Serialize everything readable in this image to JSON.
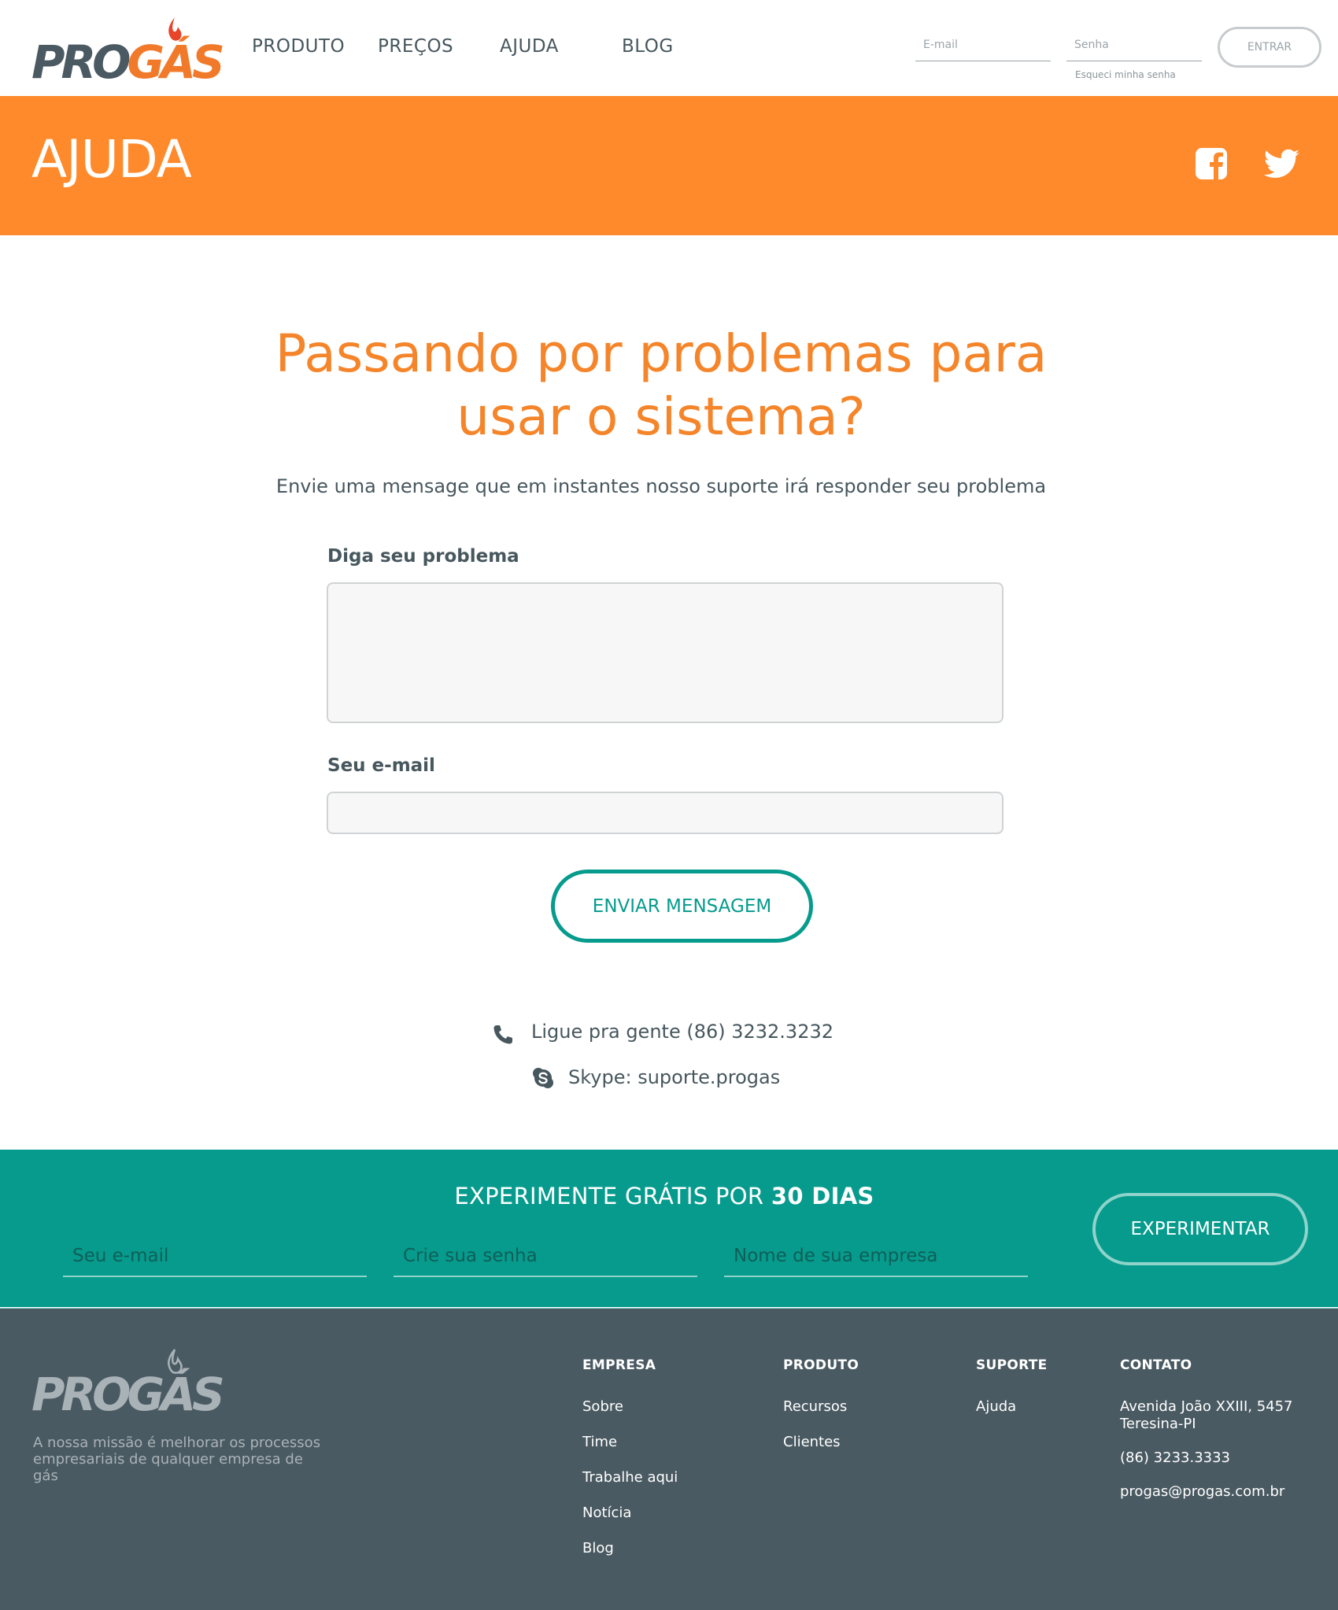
{
  "header": {
    "logo": {
      "part1": "PRO",
      "part2": "GÁS"
    },
    "nav": [
      "PRODUTO",
      "PREÇOS",
      "AJUDA",
      "BLOG"
    ],
    "email_placeholder": "E-mail",
    "password_placeholder": "Senha",
    "forgot_password": "Esqueci minha senha",
    "login_button": "ENTRAR"
  },
  "banner": {
    "title": "AJUDA",
    "social_icons": [
      "facebook-icon",
      "twitter-icon"
    ]
  },
  "main": {
    "title": "Passando por problemas para usar o sistema?",
    "subtitle": "Envie uma mensage que em instantes nosso suporte irá responder seu problema",
    "problem_label": "Diga seu problema",
    "problem_value": "",
    "email_label": "Seu e-mail",
    "email_value": "",
    "send_button": "ENVIAR MENSAGEM",
    "phone_text": "Ligue pra gente (86) 3232.3232",
    "skype_text": "Skype: suporte.progas"
  },
  "trial": {
    "title_prefix": "EXPERIMENTE GRÁTIS POR ",
    "title_bold": "30 DIAS",
    "email_placeholder": "Seu e-mail",
    "password_placeholder": "Crie sua senha",
    "company_placeholder": "Nome de sua empresa",
    "button": "EXPERIMENTAR"
  },
  "footer": {
    "logo": "PROGÁS",
    "mission": "A nossa missão é melhorar os processos empresariais de qualquer empresa de gás",
    "empresa": {
      "heading": "EMPRESA",
      "links": [
        "Sobre",
        "Time",
        "Trabalhe aqui",
        "Notícia",
        "Blog"
      ]
    },
    "produto": {
      "heading": "PRODUTO",
      "links": [
        "Recursos",
        "Clientes"
      ]
    },
    "suporte": {
      "heading": "SUPORTE",
      "links": [
        "Ajuda"
      ]
    },
    "contato": {
      "heading": "CONTATO",
      "address_line1": "Avenida João XXIII, 5457",
      "address_line2": "Teresina-PI",
      "phone": "(86) 3233.3333",
      "email": "progas@progas.com.br"
    }
  },
  "colors": {
    "orange": "#ff8a2b",
    "title_orange": "#f5852a",
    "teal": "#069b8d",
    "dark": "#47575e",
    "footer_bg": "#4a5a62"
  }
}
